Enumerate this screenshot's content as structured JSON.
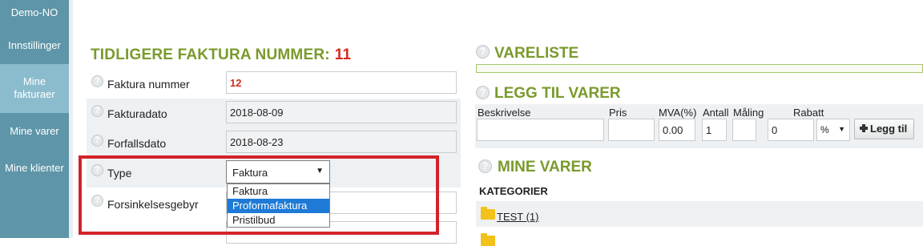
{
  "sidebar": {
    "items": [
      {
        "label": "Demo-NO"
      },
      {
        "label": "Innstillinger"
      },
      {
        "label": "Mine fakturaer"
      },
      {
        "label": "Mine varer"
      },
      {
        "label": "Mine klienter"
      }
    ]
  },
  "invoice": {
    "prev_title": "TIDLIGERE FAKTURA NUMMER:",
    "prev_number": "11",
    "fields": {
      "number_label": "Faktura nummer",
      "number_value": "12",
      "date_label": "Fakturadato",
      "date_value": "2018-08-09",
      "due_label": "Forfallsdato",
      "due_value": "2018-08-23",
      "type_label": "Type",
      "type_value": "Faktura",
      "late_fee_label": "Forsinkelsesgebyr"
    },
    "type_options": [
      "Faktura",
      "Proformafaktura",
      "Pristilbud"
    ]
  },
  "vareliste": {
    "title": "VARELISTE"
  },
  "add_items": {
    "title": "LEGG TIL VARER",
    "labels": {
      "description": "Beskrivelse",
      "price": "Pris",
      "vat": "MVA(%)",
      "qty": "Antall",
      "unit": "Måling",
      "discount": "Rabatt"
    },
    "values": {
      "vat": "0.00",
      "qty": "1",
      "discount": "0",
      "discount_unit": "%"
    },
    "add_button": "Legg til"
  },
  "my_items": {
    "title": "MINE VARER",
    "categories_label": "KATEGORIER",
    "category_link": "TEST (1)"
  },
  "icons": {
    "help": "question-circle-icon",
    "folder": "folder-icon",
    "plus": "plus-icon"
  },
  "colors": {
    "sidebar": "#5e95a8",
    "sidebar_active": "#8bbcce",
    "section_title": "#7a9a2c",
    "accent_red": "#d42b1e",
    "highlight_border": "#d2232b",
    "selected_option": "#1e7ad6"
  }
}
